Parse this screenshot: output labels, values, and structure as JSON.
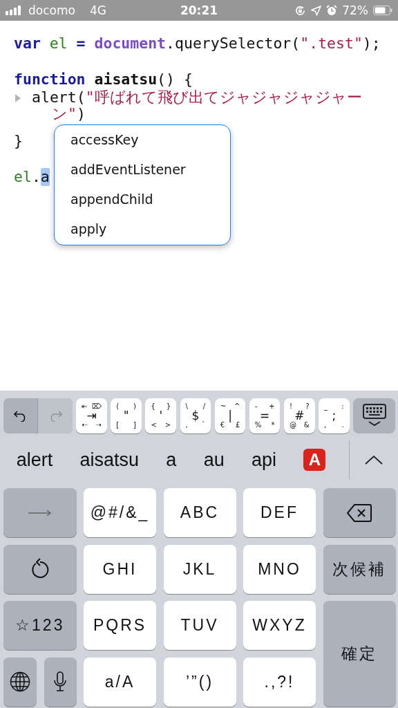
{
  "status_bar": {
    "carrier": "docomo",
    "network": "4G",
    "time": "20:21",
    "battery": "72%"
  },
  "code_lines": [
    {
      "kind": "code",
      "tokens": [
        {
          "text": "var ",
          "kind": "keyword"
        },
        {
          "text": "el",
          "kind": "variable"
        },
        {
          "text": " = ",
          "kind": "keyword"
        },
        {
          "text": "document",
          "kind": "builtin"
        },
        {
          "text": ".querySelector(",
          "kind": "plain"
        },
        {
          "text": "\".test\"",
          "kind": "string"
        },
        {
          "text": ");",
          "kind": "plain"
        }
      ]
    },
    {
      "kind": "blank"
    },
    {
      "kind": "code",
      "tokens": [
        {
          "text": "function ",
          "kind": "keyword"
        },
        {
          "text": "aisatsu",
          "kind": "name"
        },
        {
          "text": "() {",
          "kind": "plain"
        }
      ]
    },
    {
      "kind": "code",
      "disclosure": true,
      "tokens": [
        {
          "text": "alert(",
          "kind": "plain"
        },
        {
          "text": "\"呼ばれて飛び出てジャジャジャジャー",
          "kind": "string"
        }
      ]
    },
    {
      "kind": "wrap",
      "tokens": [
        {
          "text": "ン\"",
          "kind": "string"
        },
        {
          "text": ")",
          "kind": "plain"
        }
      ]
    },
    {
      "kind": "code",
      "tokens": [
        {
          "text": "}",
          "kind": "plain"
        }
      ]
    },
    {
      "kind": "blank"
    },
    {
      "kind": "code",
      "tokens": [
        {
          "text": "el",
          "kind": "variable"
        },
        {
          "text": ".",
          "kind": "plain"
        },
        {
          "text": "a",
          "kind": "selected"
        }
      ]
    }
  ],
  "completions": [
    "accessKey",
    "addEventListener",
    "appendChild",
    "apply"
  ],
  "toolbar": {
    "undo_disabled": false,
    "redo_disabled": true,
    "symbol_keys": [
      {
        "chars": [
          "⇤",
          "⌦",
          "⇥",
          "⇠",
          "⇢"
        ]
      },
      {
        "chars": [
          "(",
          ")",
          "\"",
          "[",
          "]"
        ]
      },
      {
        "chars": [
          "{",
          "}",
          "'",
          "<",
          ">"
        ]
      },
      {
        "chars": [
          "\\",
          "/",
          "$",
          ",",
          "`"
        ]
      },
      {
        "chars": [
          "~",
          "^",
          "|",
          "€",
          "£"
        ]
      },
      {
        "chars": [
          "-",
          "+",
          "=",
          "%",
          "*"
        ]
      },
      {
        "chars": [
          "!",
          "?",
          "#",
          "@",
          "&"
        ]
      },
      {
        "chars": [
          "_",
          ":",
          ";",
          ",",
          "."
        ]
      }
    ]
  },
  "candidates": [
    {
      "text": "alert",
      "kind": "word"
    },
    {
      "text": "aisatsu",
      "kind": "word"
    },
    {
      "text": "a",
      "kind": "word"
    },
    {
      "text": "au",
      "kind": "word"
    },
    {
      "text": "api",
      "kind": "word"
    },
    {
      "text": "A",
      "kind": "emoji"
    }
  ],
  "keys": [
    {
      "kind": "arrow"
    },
    {
      "kind": "char",
      "label": "@#/&_"
    },
    {
      "kind": "char",
      "label": "ABC"
    },
    {
      "kind": "char",
      "label": "DEF"
    },
    {
      "kind": "backspace"
    },
    {
      "kind": "undo"
    },
    {
      "kind": "char",
      "label": "GHI"
    },
    {
      "kind": "char",
      "label": "JKL"
    },
    {
      "kind": "char",
      "label": "MNO"
    },
    {
      "kind": "action",
      "label": "次候補"
    },
    {
      "kind": "action",
      "label": "☆123"
    },
    {
      "kind": "char",
      "label": "PQRS"
    },
    {
      "kind": "char",
      "label": "TUV"
    },
    {
      "kind": "char",
      "label": "WXYZ"
    },
    {
      "kind": "action",
      "label": "確定"
    },
    {
      "kind": "globe"
    },
    {
      "kind": "mic"
    },
    {
      "kind": "char",
      "label": "a/A"
    },
    {
      "kind": "char",
      "label": "’”()"
    },
    {
      "kind": "char",
      "label": ".,?!"
    }
  ]
}
